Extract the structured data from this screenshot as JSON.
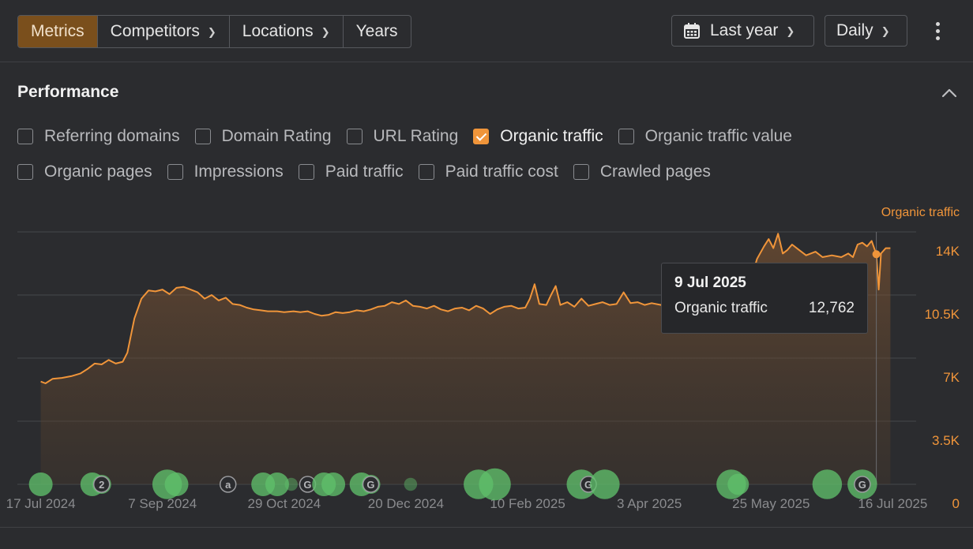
{
  "toolbar": {
    "tabs": [
      {
        "label": "Metrics",
        "active": true
      },
      {
        "label": "Competitors",
        "dropdown": true
      },
      {
        "label": "Locations",
        "dropdown": true
      },
      {
        "label": "Years"
      }
    ],
    "period": {
      "label": "Last year",
      "icon": "calendar-icon"
    },
    "granularity": {
      "label": "Daily"
    },
    "more_icon": "kebab-icon"
  },
  "performance": {
    "title": "Performance",
    "metrics_row1": [
      {
        "label": "Referring domains",
        "checked": false
      },
      {
        "label": "Domain Rating",
        "checked": false
      },
      {
        "label": "URL Rating",
        "checked": false
      },
      {
        "label": "Organic traffic",
        "checked": true
      },
      {
        "label": "Organic traffic value",
        "checked": false
      }
    ],
    "metrics_row2": [
      {
        "label": "Organic pages",
        "checked": false
      },
      {
        "label": "Impressions",
        "checked": false
      },
      {
        "label": "Paid traffic",
        "checked": false
      },
      {
        "label": "Paid traffic cost",
        "checked": false
      },
      {
        "label": "Crawled pages",
        "checked": false
      }
    ]
  },
  "tooltip": {
    "date": "9 Jul 2025",
    "metric": "Organic traffic",
    "value": "12,762"
  },
  "colors": {
    "accent": "#f0953a",
    "event_green": "#5fbf6a",
    "grid": "#45474b"
  },
  "chart_data": {
    "type": "area",
    "series": [
      {
        "name": "Organic traffic",
        "color": "#f0953a"
      }
    ],
    "y_axis_title": "Organic traffic",
    "ylim": [
      0,
      14000
    ],
    "yticks": [
      0,
      3500,
      7000,
      10500,
      14000
    ],
    "ytick_labels": [
      "0",
      "3.5K",
      "7K",
      "10.5K",
      "14K"
    ],
    "xlim": [
      "2024-07-07",
      "2025-07-26"
    ],
    "xtick_labels": [
      {
        "date": "2024-07-17",
        "label": "17 Jul 2024"
      },
      {
        "date": "2024-09-07",
        "label": "7 Sep 2024"
      },
      {
        "date": "2024-10-29",
        "label": "29 Oct 2024"
      },
      {
        "date": "2024-12-20",
        "label": "20 Dec 2024"
      },
      {
        "date": "2025-02-10",
        "label": "10 Feb 2025"
      },
      {
        "date": "2025-04-03",
        "label": "3 Apr 2025"
      },
      {
        "date": "2025-05-25",
        "label": "25 May 2025"
      },
      {
        "date": "2025-07-16",
        "label": "16 Jul 2025"
      }
    ],
    "points": [
      [
        "2024-07-17",
        5700
      ],
      [
        "2024-07-19",
        5600
      ],
      [
        "2024-07-22",
        5850
      ],
      [
        "2024-07-26",
        5900
      ],
      [
        "2024-07-30",
        6000
      ],
      [
        "2024-08-03",
        6150
      ],
      [
        "2024-08-06",
        6400
      ],
      [
        "2024-08-09",
        6700
      ],
      [
        "2024-08-12",
        6650
      ],
      [
        "2024-08-15",
        6900
      ],
      [
        "2024-08-18",
        6700
      ],
      [
        "2024-08-21",
        6800
      ],
      [
        "2024-08-23",
        7300
      ],
      [
        "2024-08-26",
        9200
      ],
      [
        "2024-08-29",
        10300
      ],
      [
        "2024-09-01",
        10750
      ],
      [
        "2024-09-04",
        10700
      ],
      [
        "2024-09-07",
        10800
      ],
      [
        "2024-09-10",
        10550
      ],
      [
        "2024-09-13",
        10900
      ],
      [
        "2024-09-16",
        10950
      ],
      [
        "2024-09-19",
        10800
      ],
      [
        "2024-09-22",
        10650
      ],
      [
        "2024-09-25",
        10300
      ],
      [
        "2024-09-28",
        10500
      ],
      [
        "2024-10-01",
        10200
      ],
      [
        "2024-10-04",
        10350
      ],
      [
        "2024-10-07",
        10000
      ],
      [
        "2024-10-10",
        9950
      ],
      [
        "2024-10-13",
        9800
      ],
      [
        "2024-10-16",
        9700
      ],
      [
        "2024-10-19",
        9650
      ],
      [
        "2024-10-22",
        9600
      ],
      [
        "2024-10-26",
        9600
      ],
      [
        "2024-10-29",
        9550
      ],
      [
        "2024-11-02",
        9600
      ],
      [
        "2024-11-05",
        9550
      ],
      [
        "2024-11-08",
        9600
      ],
      [
        "2024-11-11",
        9450
      ],
      [
        "2024-11-14",
        9350
      ],
      [
        "2024-11-17",
        9400
      ],
      [
        "2024-11-20",
        9550
      ],
      [
        "2024-11-23",
        9500
      ],
      [
        "2024-11-26",
        9550
      ],
      [
        "2024-11-29",
        9650
      ],
      [
        "2024-12-02",
        9600
      ],
      [
        "2024-12-05",
        9700
      ],
      [
        "2024-12-08",
        9850
      ],
      [
        "2024-12-11",
        9900
      ],
      [
        "2024-12-14",
        10100
      ],
      [
        "2024-12-17",
        10000
      ],
      [
        "2024-12-20",
        10200
      ],
      [
        "2024-12-23",
        9900
      ],
      [
        "2024-12-26",
        9850
      ],
      [
        "2024-12-29",
        9750
      ],
      [
        "2025-01-01",
        9900
      ],
      [
        "2025-01-04",
        9700
      ],
      [
        "2025-01-07",
        9600
      ],
      [
        "2025-01-10",
        9750
      ],
      [
        "2025-01-13",
        9800
      ],
      [
        "2025-01-16",
        9650
      ],
      [
        "2025-01-19",
        9900
      ],
      [
        "2025-01-22",
        9750
      ],
      [
        "2025-01-25",
        9450
      ],
      [
        "2025-01-28",
        9700
      ],
      [
        "2025-01-31",
        9850
      ],
      [
        "2025-02-03",
        9900
      ],
      [
        "2025-02-06",
        9750
      ],
      [
        "2025-02-09",
        9800
      ],
      [
        "2025-02-11",
        10300
      ],
      [
        "2025-02-13",
        11100
      ],
      [
        "2025-02-15",
        10000
      ],
      [
        "2025-02-18",
        9950
      ],
      [
        "2025-02-20",
        10500
      ],
      [
        "2025-02-22",
        11000
      ],
      [
        "2025-02-24",
        9950
      ],
      [
        "2025-02-27",
        10100
      ],
      [
        "2025-03-02",
        9850
      ],
      [
        "2025-03-05",
        10300
      ],
      [
        "2025-03-08",
        9900
      ],
      [
        "2025-03-11",
        10000
      ],
      [
        "2025-03-14",
        10100
      ],
      [
        "2025-03-17",
        9950
      ],
      [
        "2025-03-20",
        10000
      ],
      [
        "2025-03-23",
        10650
      ],
      [
        "2025-03-26",
        10050
      ],
      [
        "2025-03-29",
        10100
      ],
      [
        "2025-04-01",
        9950
      ],
      [
        "2025-04-04",
        10050
      ],
      [
        "2025-04-08",
        9950
      ],
      [
        "2025-04-12",
        10050
      ],
      [
        "2025-04-15",
        9950
      ],
      [
        "2025-04-18",
        10000
      ],
      [
        "2025-04-21",
        10050
      ],
      [
        "2025-04-25",
        9900
      ],
      [
        "2025-04-29",
        10100
      ],
      [
        "2025-05-02",
        10200
      ],
      [
        "2025-05-06",
        10300
      ],
      [
        "2025-05-10",
        10400
      ],
      [
        "2025-05-14",
        10600
      ],
      [
        "2025-05-17",
        11600
      ],
      [
        "2025-05-19",
        12500
      ],
      [
        "2025-05-22",
        13200
      ],
      [
        "2025-05-24",
        13600
      ],
      [
        "2025-05-26",
        13100
      ],
      [
        "2025-05-28",
        13900
      ],
      [
        "2025-05-30",
        12800
      ],
      [
        "2025-06-01",
        13000
      ],
      [
        "2025-06-03",
        13300
      ],
      [
        "2025-06-06",
        13000
      ],
      [
        "2025-06-09",
        12700
      ],
      [
        "2025-06-13",
        12900
      ],
      [
        "2025-06-16",
        12600
      ],
      [
        "2025-06-20",
        12700
      ],
      [
        "2025-06-24",
        12600
      ],
      [
        "2025-06-27",
        12800
      ],
      [
        "2025-06-29",
        12600
      ],
      [
        "2025-07-01",
        13300
      ],
      [
        "2025-07-03",
        13400
      ],
      [
        "2025-07-05",
        13200
      ],
      [
        "2025-07-07",
        13500
      ],
      [
        "2025-07-09",
        12762
      ],
      [
        "2025-07-10",
        10800
      ],
      [
        "2025-07-11",
        12800
      ],
      [
        "2025-07-13",
        13100
      ],
      [
        "2025-07-15",
        13100
      ]
    ],
    "highlight": {
      "date": "2025-07-09",
      "value": 12762
    },
    "event_markers": [
      {
        "date": "2024-07-17",
        "size": 1.0
      },
      {
        "date": "2024-08-08",
        "size": 1.0
      },
      {
        "date": "2024-08-12",
        "size": 0.8,
        "badge": "2"
      },
      {
        "date": "2024-09-09",
        "size": 1.25
      },
      {
        "date": "2024-09-13",
        "size": 1.0
      },
      {
        "date": "2024-10-05",
        "size": 0,
        "badge": "a"
      },
      {
        "date": "2024-10-20",
        "size": 1.0
      },
      {
        "date": "2024-10-26",
        "size": 1.0
      },
      {
        "date": "2024-11-01",
        "size": 0.55
      },
      {
        "date": "2024-11-08",
        "size": 0,
        "badge": "G"
      },
      {
        "date": "2024-11-15",
        "size": 1.0
      },
      {
        "date": "2024-11-19",
        "size": 1.0
      },
      {
        "date": "2024-12-01",
        "size": 1.0
      },
      {
        "date": "2024-12-05",
        "size": 0.8,
        "badge": "G"
      },
      {
        "date": "2024-12-22",
        "size": 0.55
      },
      {
        "date": "2025-01-20",
        "size": 1.25
      },
      {
        "date": "2025-01-27",
        "size": 1.35
      },
      {
        "date": "2025-03-05",
        "size": 1.25
      },
      {
        "date": "2025-03-08",
        "size": 0,
        "badge": "G"
      },
      {
        "date": "2025-03-15",
        "size": 1.25
      },
      {
        "date": "2025-05-08",
        "size": 1.25
      },
      {
        "date": "2025-05-11",
        "size": 0.9
      },
      {
        "date": "2025-06-18",
        "size": 1.25
      },
      {
        "date": "2025-07-03",
        "size": 1.25,
        "badge": "G"
      }
    ]
  }
}
